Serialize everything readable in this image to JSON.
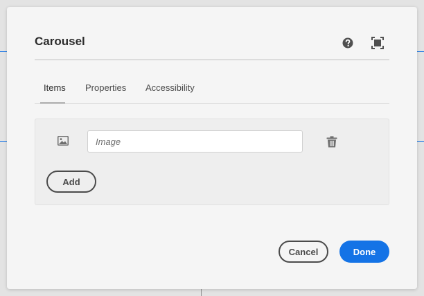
{
  "dialog": {
    "title": "Carousel",
    "help_icon": "help-circle-icon",
    "fullscreen_icon": "fullscreen-icon"
  },
  "tabs": [
    {
      "label": "Items",
      "active": true
    },
    {
      "label": "Properties",
      "active": false
    },
    {
      "label": "Accessibility",
      "active": false
    }
  ],
  "items_panel": {
    "image_icon": "image-icon",
    "image_field": {
      "value": "",
      "placeholder": "Image"
    },
    "delete_icon": "trash-icon",
    "add_label": "Add"
  },
  "footer": {
    "cancel_label": "Cancel",
    "done_label": "Done"
  },
  "colors": {
    "accent": "#1473e6",
    "dialog_background": "#f5f5f5",
    "panel_background": "#eeeeee"
  }
}
